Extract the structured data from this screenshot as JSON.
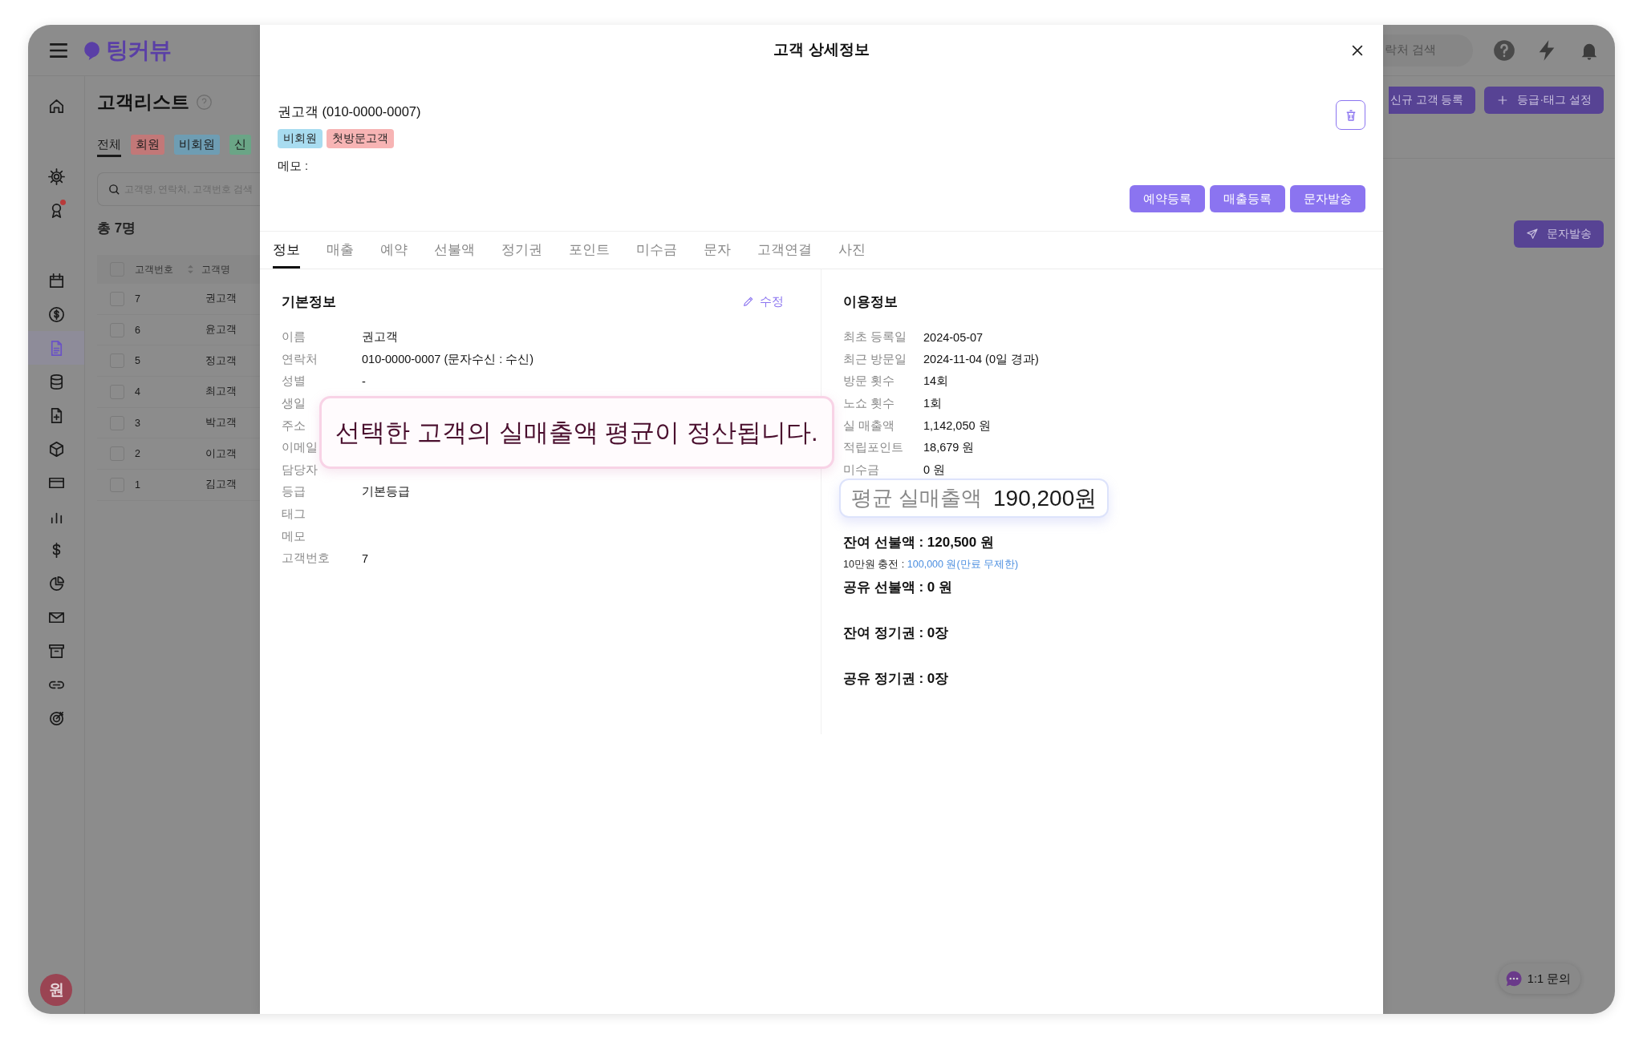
{
  "app": {
    "logo": "팅커뷰",
    "sidebar": {
      "groups": [
        {
          "items": [
            {
              "kind": "home",
              "selected": false,
              "alert": false
            }
          ]
        },
        {
          "items": [
            {
              "kind": "gear",
              "selected": false,
              "alert": false
            },
            {
              "kind": "ribbon",
              "selected": false,
              "alert": true
            }
          ]
        },
        {
          "items": [
            {
              "kind": "calendar",
              "selected": false,
              "alert": false
            },
            {
              "kind": "coin",
              "selected": false,
              "alert": false
            },
            {
              "kind": "document",
              "selected": true,
              "alert": false
            },
            {
              "kind": "database",
              "selected": false,
              "alert": false
            },
            {
              "kind": "fileplus",
              "selected": false,
              "alert": false
            },
            {
              "kind": "box",
              "selected": false,
              "alert": false
            },
            {
              "kind": "card",
              "selected": false,
              "alert": false
            },
            {
              "kind": "chart",
              "selected": false,
              "alert": false
            },
            {
              "kind": "dollar",
              "selected": false,
              "alert": false
            },
            {
              "kind": "pie",
              "selected": false,
              "alert": false
            },
            {
              "kind": "mail",
              "selected": false,
              "alert": false
            },
            {
              "kind": "archive",
              "selected": false,
              "alert": false
            },
            {
              "kind": "link",
              "selected": false,
              "alert": false
            },
            {
              "kind": "target",
              "selected": false,
              "alert": false
            }
          ]
        }
      ]
    },
    "avatar": "원",
    "header_search": {
      "placeholder": "락처 검색"
    },
    "page": {
      "title": "고객리스트",
      "tabs": [
        {
          "label": "전체",
          "selected": true
        },
        {
          "label": "회원",
          "selected": false,
          "color": "#c27878"
        },
        {
          "label": "비회원",
          "selected": false,
          "color": "#6e9db3"
        },
        {
          "label": "신",
          "selected": false,
          "color": "#6aa586"
        }
      ],
      "search": {
        "placeholder": "고객명, 연락처, 고객번호 검색"
      },
      "total": "총 7명",
      "table": {
        "columns": [
          "고객번호",
          "고객명"
        ],
        "header_checked": false,
        "rows": [
          {
            "number": "7",
            "name": "권고객",
            "checked": false
          },
          {
            "number": "6",
            "name": "윤고객",
            "checked": false
          },
          {
            "number": "5",
            "name": "정고객",
            "checked": false
          },
          {
            "number": "4",
            "name": "최고객",
            "checked": false
          },
          {
            "number": "3",
            "name": "박고객",
            "checked": false
          },
          {
            "number": "2",
            "name": "이고객",
            "checked": false
          },
          {
            "number": "1",
            "name": "김고객",
            "checked": false
          }
        ]
      }
    },
    "actions": [
      {
        "label": "신규 고객 등록",
        "kind": "plain"
      },
      {
        "label": "등급·태그 설정",
        "kind": "add"
      }
    ],
    "send_button": "문자발송",
    "chat": "1:1 문의"
  },
  "modal": {
    "title": "고객 상세정보",
    "customer": "권고객 (010-0000-0007)",
    "tags": [
      {
        "label": "비회원",
        "color": "#a8dcf0"
      },
      {
        "label": "첫방문고객",
        "color": "#f7b4b4"
      }
    ],
    "memo_label": "메모 :",
    "actions": [
      "예약등록",
      "매출등록",
      "문자발송"
    ],
    "tabs": [
      {
        "label": "정보",
        "selected": true
      },
      {
        "label": "매출",
        "selected": false
      },
      {
        "label": "예약",
        "selected": false
      },
      {
        "label": "선불액",
        "selected": false
      },
      {
        "label": "정기권",
        "selected": false
      },
      {
        "label": "포인트",
        "selected": false
      },
      {
        "label": "미수금",
        "selected": false
      },
      {
        "label": "문자",
        "selected": false
      },
      {
        "label": "고객연결",
        "selected": false
      },
      {
        "label": "사진",
        "selected": false
      }
    ],
    "basic": {
      "heading": "기본정보",
      "edit": "수정",
      "rows": [
        {
          "label": "이름",
          "value": "권고객"
        },
        {
          "label": "연락처",
          "value": "010-0000-0007 (문자수신 : 수신)"
        },
        {
          "label": "성별",
          "value": "-"
        },
        {
          "label": "생일"
        },
        {
          "label": "주소"
        },
        {
          "label": "이메일"
        },
        {
          "label": "담당자"
        },
        {
          "label": "등급",
          "value": "기본등급"
        },
        {
          "label": "태그"
        },
        {
          "label": "메모"
        },
        {
          "label": "고객번호",
          "value": "7"
        }
      ]
    },
    "usage": {
      "heading": "이용정보",
      "rows": [
        {
          "label": "최초 등록일",
          "value": "2024-05-07"
        },
        {
          "label": "최근 방문일",
          "value": "2024-11-04 (0일 경과)"
        },
        {
          "label": "방문 횟수",
          "value": "14회"
        },
        {
          "label": "노쇼 횟수",
          "value": "1회"
        },
        {
          "label": "실 매출액",
          "value": "1,142,050 원"
        },
        {
          "label": "적립포인트",
          "value": "18,679 원"
        },
        {
          "label": "미수금",
          "value": "0 원"
        }
      ],
      "balances": [
        {
          "text": "잔여 선불액 : 120,500 원",
          "detail": {
            "label": "10만원 충전 : ",
            "value": "100,000 원(만료 무제한)"
          }
        },
        {
          "text": "공유 선불액 : 0 원"
        },
        {
          "text": "잔여 정기권 : 0장"
        },
        {
          "text": "공유 정기권 : 0장"
        }
      ]
    }
  },
  "callouts": [
    {
      "kind": "note",
      "text": "선택한 고객의 실매출액 평균이 정산됩니다."
    },
    {
      "kind": "figure",
      "label": "평균 실매출액",
      "value": "190,200원"
    }
  ]
}
